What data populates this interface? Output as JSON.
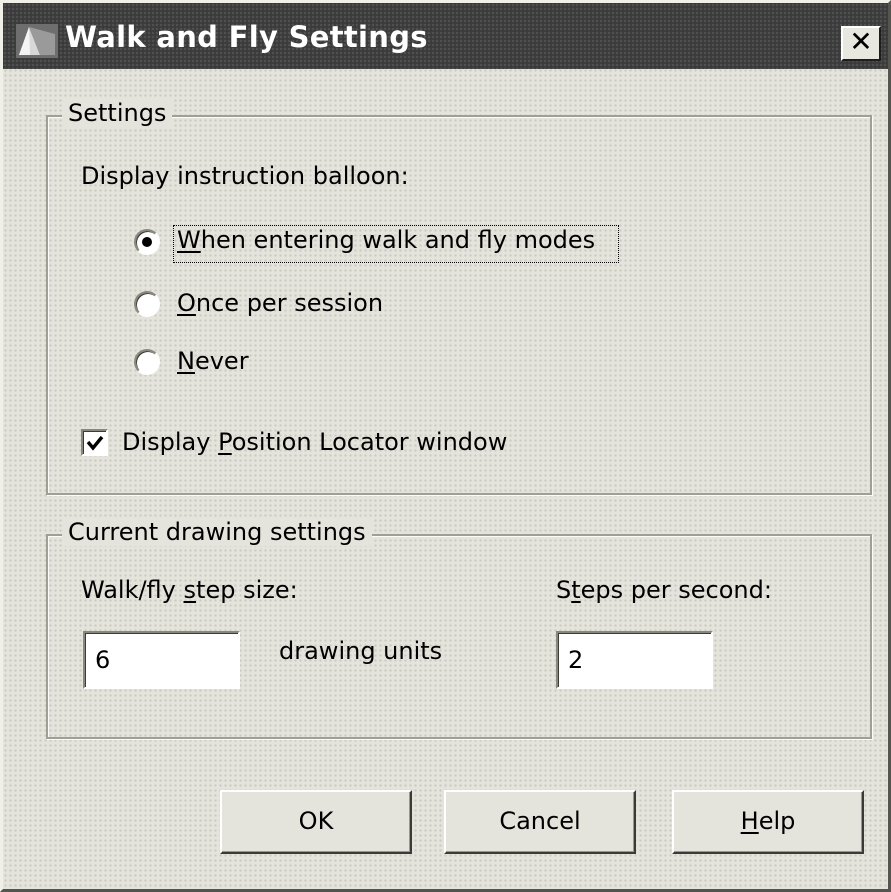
{
  "window": {
    "title": "Walk and Fly Settings",
    "icon": "app-icon",
    "close_label": "✕"
  },
  "settings": {
    "legend": "Settings",
    "balloon_label": "Display instruction balloon:",
    "balloon_options": [
      {
        "pre": "",
        "accel": "W",
        "post": "hen entering walk and fly modes",
        "selected": true
      },
      {
        "pre": "",
        "accel": "O",
        "post": "nce per session",
        "selected": false
      },
      {
        "pre": "",
        "accel": "N",
        "post": "ever",
        "selected": false
      }
    ],
    "locator": {
      "pre": "Display ",
      "accel": "P",
      "post": "osition Locator window",
      "checked": true
    }
  },
  "drawing": {
    "legend": "Current drawing settings",
    "step_size": {
      "pre": "Walk/fly ",
      "accel": "s",
      "post": "tep size:",
      "value": "6"
    },
    "units_label": "drawing units",
    "steps_per_second": {
      "pre": "S",
      "accel": "t",
      "post": "eps per second:",
      "value": "2"
    }
  },
  "buttons": {
    "ok": {
      "label": "OK"
    },
    "cancel": {
      "label": "Cancel"
    },
    "help": {
      "pre": "",
      "accel": "H",
      "post": "elp"
    }
  }
}
